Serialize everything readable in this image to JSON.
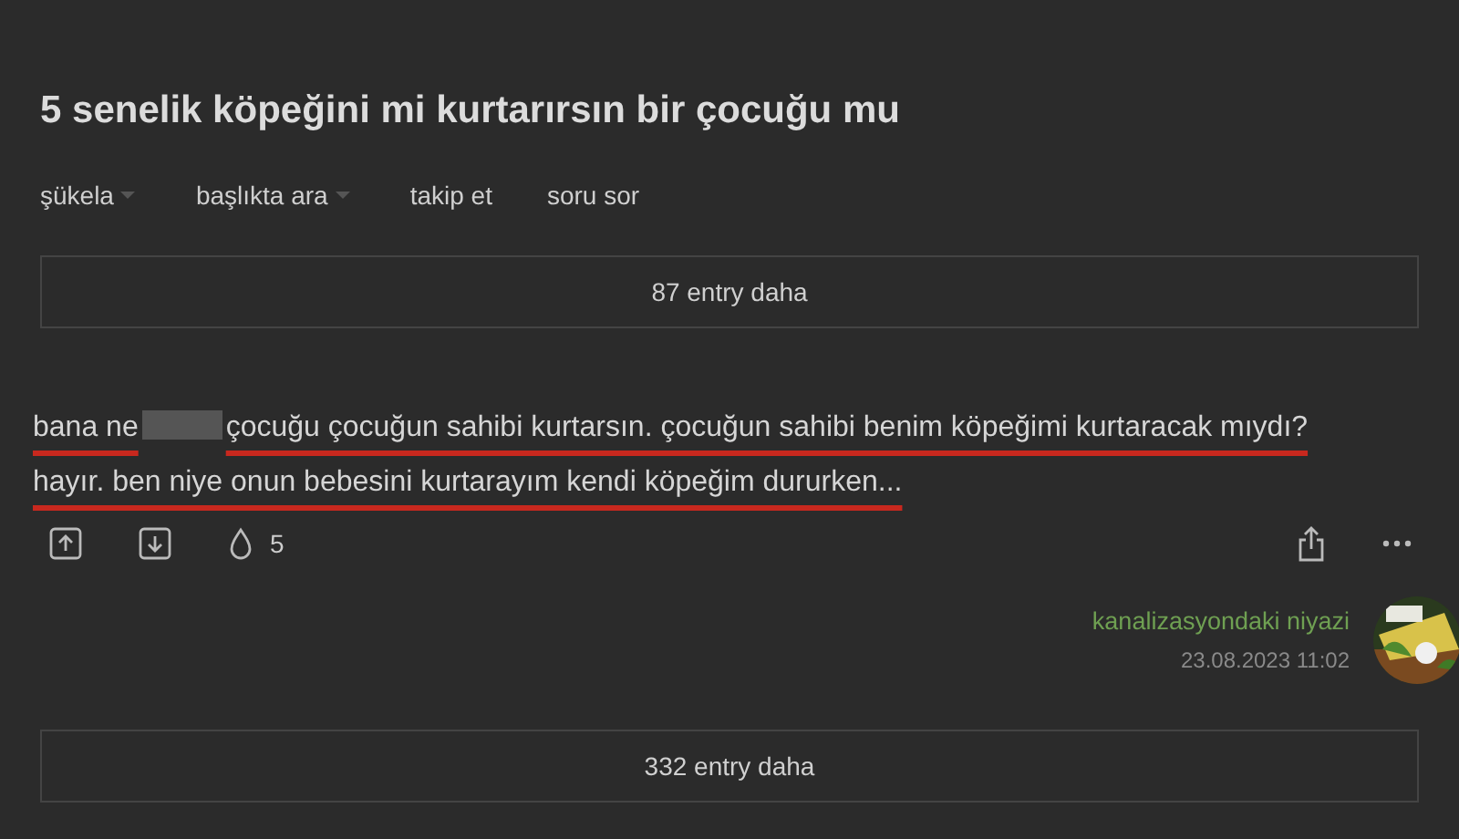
{
  "topic": {
    "title": "5 senelik köpeğini mi kurtarırsın bir çocuğu mu"
  },
  "nav": [
    {
      "label": "şükela",
      "dropdown": true
    },
    {
      "label": "başlıkta ara",
      "dropdown": true
    },
    {
      "label": "takip et",
      "dropdown": false
    },
    {
      "label": "soru sor",
      "dropdown": false
    }
  ],
  "more_before": {
    "label": "87 entry daha"
  },
  "entry": {
    "text_before": "bana ne",
    "censored": true,
    "text_after": "çocuğu çocuğun sahibi kurtarsın. çocuğun sahibi benim köpeğimi kurtaracak mıydı? hayır. ben niye onun bebesini kurtarayım kendi köpeğim dururken...",
    "underlined": true,
    "favorites": "5",
    "author": "kanalizasyondaki niyazi",
    "date": "23.08.2023 11:02"
  },
  "more_after": {
    "label": "332 entry daha"
  }
}
